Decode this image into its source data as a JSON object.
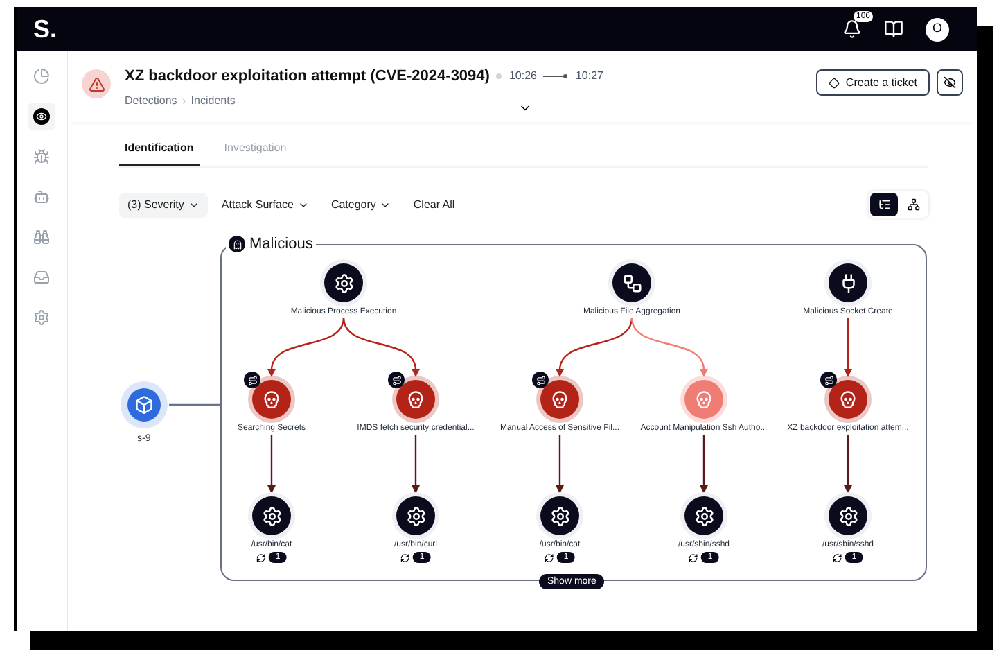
{
  "app": {
    "logo": "S.",
    "notifications": "106",
    "avatar": "O"
  },
  "sidebar": {
    "items": [
      {
        "kind": "dashboard",
        "selected": false
      },
      {
        "kind": "detections",
        "selected": true
      },
      {
        "kind": "bugs",
        "selected": false
      },
      {
        "kind": "bots",
        "selected": false
      },
      {
        "kind": "explore",
        "selected": false
      },
      {
        "kind": "inbox",
        "selected": false
      },
      {
        "kind": "settings",
        "selected": false
      }
    ]
  },
  "incident": {
    "title": "XZ backdoor exploitation attempt (CVE-2024-3094)",
    "start": "10:26",
    "end": "10:27",
    "breadcrumb": [
      "Detections",
      "Incidents"
    ],
    "action": "Create a ticket"
  },
  "tabs": [
    {
      "label": "Identification",
      "selected": true
    },
    {
      "label": "Investigation",
      "selected": false
    }
  ],
  "filters": [
    {
      "label": "(3) Severity",
      "kind": "dropdown",
      "active": true
    },
    {
      "label": "Attack Surface",
      "kind": "dropdown",
      "active": false
    },
    {
      "label": "Category",
      "kind": "dropdown",
      "active": false
    },
    {
      "label": "Clear All",
      "kind": "action",
      "active": false
    }
  ],
  "view_toggle": [
    {
      "kind": "graph",
      "selected": true
    },
    {
      "kind": "tree",
      "selected": false
    }
  ],
  "graph": {
    "source": {
      "label": "s-9"
    },
    "show_more": "Show more",
    "group": {
      "label": "Malicious",
      "categories": [
        {
          "label": "Malicious Process Execution",
          "kind": "process",
          "children": [
            {
              "label": "Searching Secrets",
              "color": "#b42318",
              "flagged": true,
              "children": [
                {
                  "label": "/usr/bin/cat",
                  "count": "1"
                }
              ]
            },
            {
              "label": "IMDS fetch security credential...",
              "color": "#b42318",
              "flagged": true,
              "children": [
                {
                  "label": "/usr/bin/curl",
                  "count": "1"
                }
              ]
            }
          ]
        },
        {
          "label": "Malicious File Aggregation",
          "kind": "file",
          "children": [
            {
              "label": "Manual Access of Sensitive Fil...",
              "color": "#b42318",
              "flagged": true,
              "children": [
                {
                  "label": "/usr/bin/cat",
                  "count": "1"
                }
              ]
            },
            {
              "label": "Account Manipulation Ssh Autho...",
              "color": "#ef7d74",
              "flagged": false,
              "children": [
                {
                  "label": "/usr/sbin/sshd",
                  "count": "1"
                }
              ]
            }
          ]
        },
        {
          "label": "Malicious Socket Create",
          "kind": "socket",
          "children": [
            {
              "label": "XZ backdoor exploitation attem...",
              "color": "#b42318",
              "flagged": true,
              "children": [
                {
                  "label": "/usr/sbin/sshd",
                  "count": "1"
                }
              ]
            }
          ]
        }
      ]
    }
  }
}
